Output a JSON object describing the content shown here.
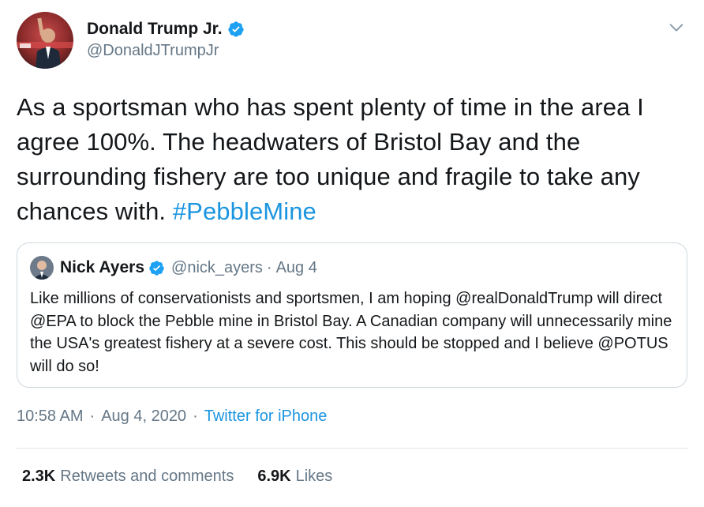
{
  "author": {
    "name": "Donald Trump Jr.",
    "handle": "@DonaldJTrumpJr"
  },
  "tweet": {
    "text": "As a sportsman who has spent plenty of time in the area I agree 100%. The headwaters of Bristol Bay and the surrounding fishery are too unique and fragile to take any chances with.",
    "hashtag": "#PebbleMine"
  },
  "quote": {
    "name": "Nick Ayers",
    "handle": "@nick_ayers",
    "separator": "·",
    "date": "Aug 4",
    "text": "Like millions of conservationists and sportsmen, I am hoping @realDonaldTrump will direct @EPA to block the Pebble mine in Bristol Bay. A Canadian company will unnecessarily mine the USA's greatest fishery at a severe cost. This should be stopped and I believe @POTUS will do so!"
  },
  "meta": {
    "time": "10:58 AM",
    "separator": "·",
    "date": "Aug 4, 2020",
    "source": "Twitter for iPhone"
  },
  "stats": {
    "retweets_count": "2.3K",
    "retweets_label": "Retweets and comments",
    "likes_count": "6.9K",
    "likes_label": "Likes"
  },
  "icons": {
    "verified": "verified-badge-icon",
    "menu": "chevron-down-icon"
  },
  "colors": {
    "link": "#1b95e0",
    "verified": "#1da1f2",
    "secondary_text": "#657786",
    "border": "#cfd9de"
  }
}
